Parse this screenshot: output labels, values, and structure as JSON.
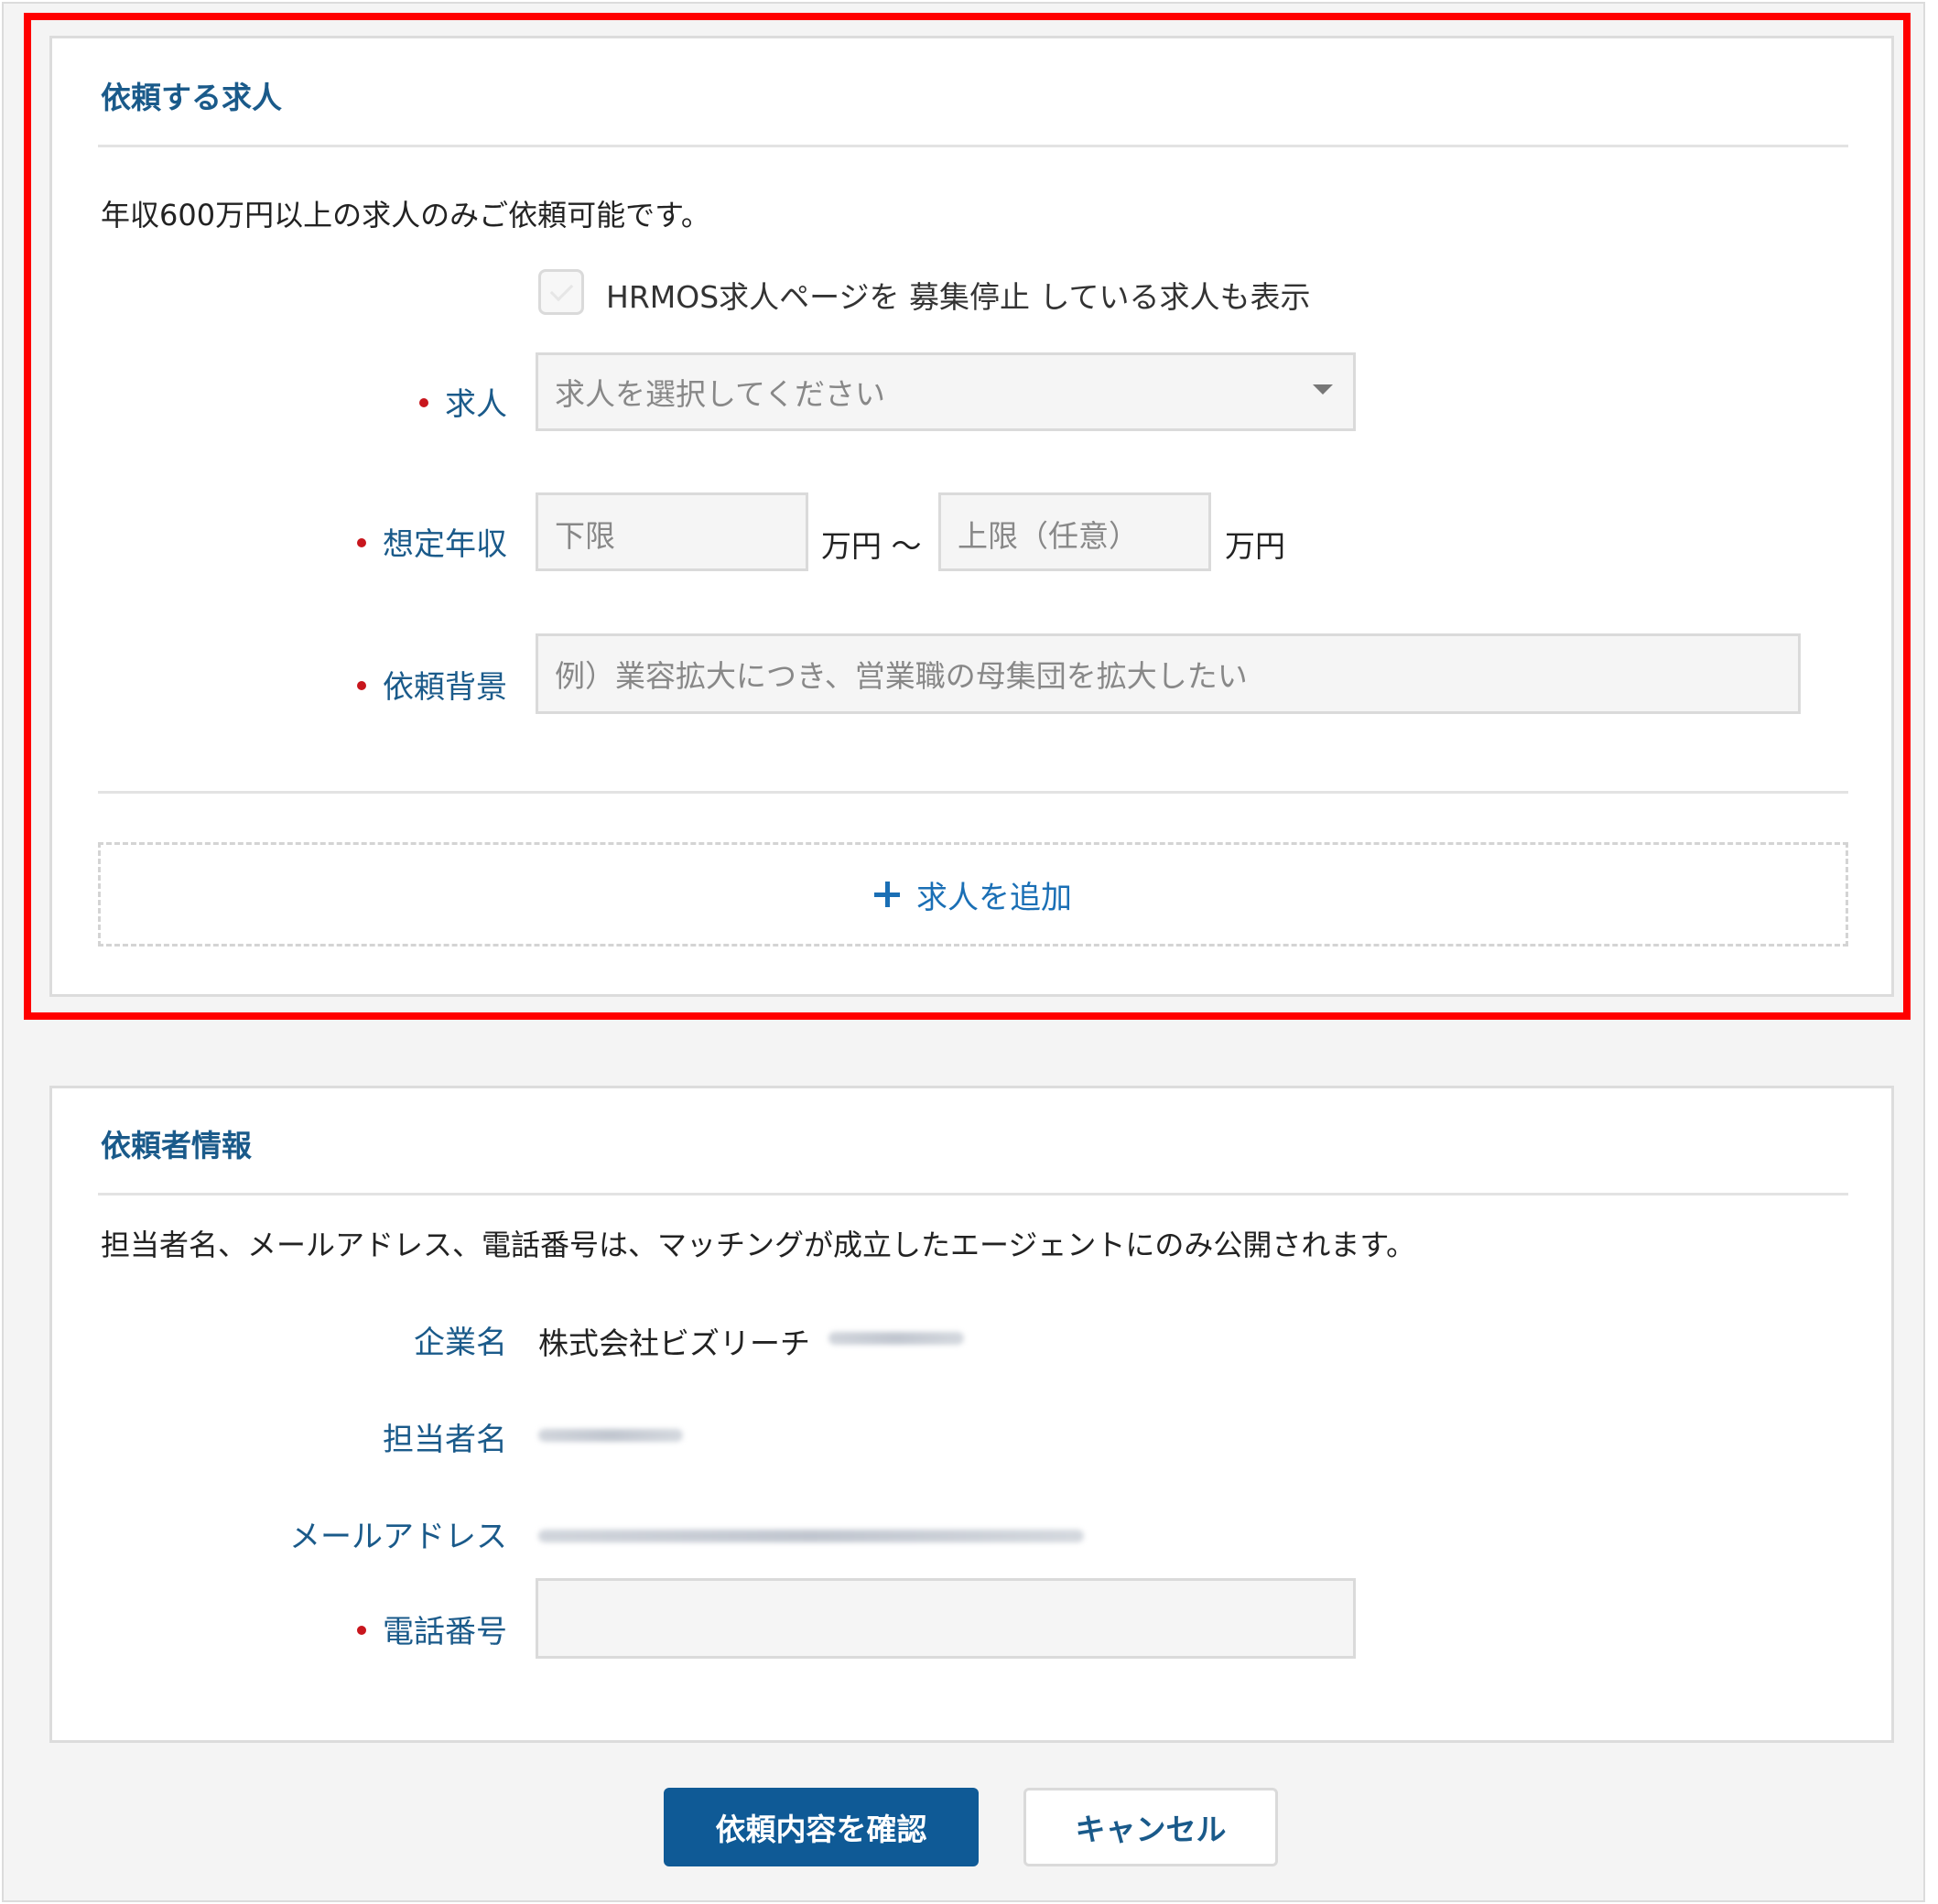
{
  "job_section": {
    "title": "依頼する求人",
    "description": "年収600万円以上の求人のみご依頼可能です。",
    "checkbox_label": "HRMOS求人ページを 募集停止 している求人も表示",
    "job": {
      "label": "求人",
      "placeholder": "求人を選択してください"
    },
    "salary": {
      "label": "想定年収",
      "lower_placeholder": "下限",
      "unit1": "万円 ～",
      "upper_placeholder": "上限（任意）",
      "unit2": "万円"
    },
    "background": {
      "label": "依頼背景",
      "placeholder": "例）業容拡大につき、営業職の母集団を拡大したい"
    },
    "add_job_label": "求人を追加"
  },
  "requester_section": {
    "title": "依頼者情報",
    "description": "担当者名、メールアドレス、電話番号は、マッチングが成立したエージェントにのみ公開されます。",
    "company": {
      "label": "企業名",
      "value": "株式会社ビズリーチ"
    },
    "person": {
      "label": "担当者名"
    },
    "email": {
      "label": "メールアドレス"
    },
    "phone": {
      "label": "電話番号",
      "value": ""
    }
  },
  "actions": {
    "confirm_label": "依頼内容を確認",
    "cancel_label": "キャンセル"
  },
  "colors": {
    "accent": "#1a5a8a",
    "primary_button": "#0f5a96",
    "required_dot": "#c8161d",
    "highlight": "#ff0000"
  }
}
